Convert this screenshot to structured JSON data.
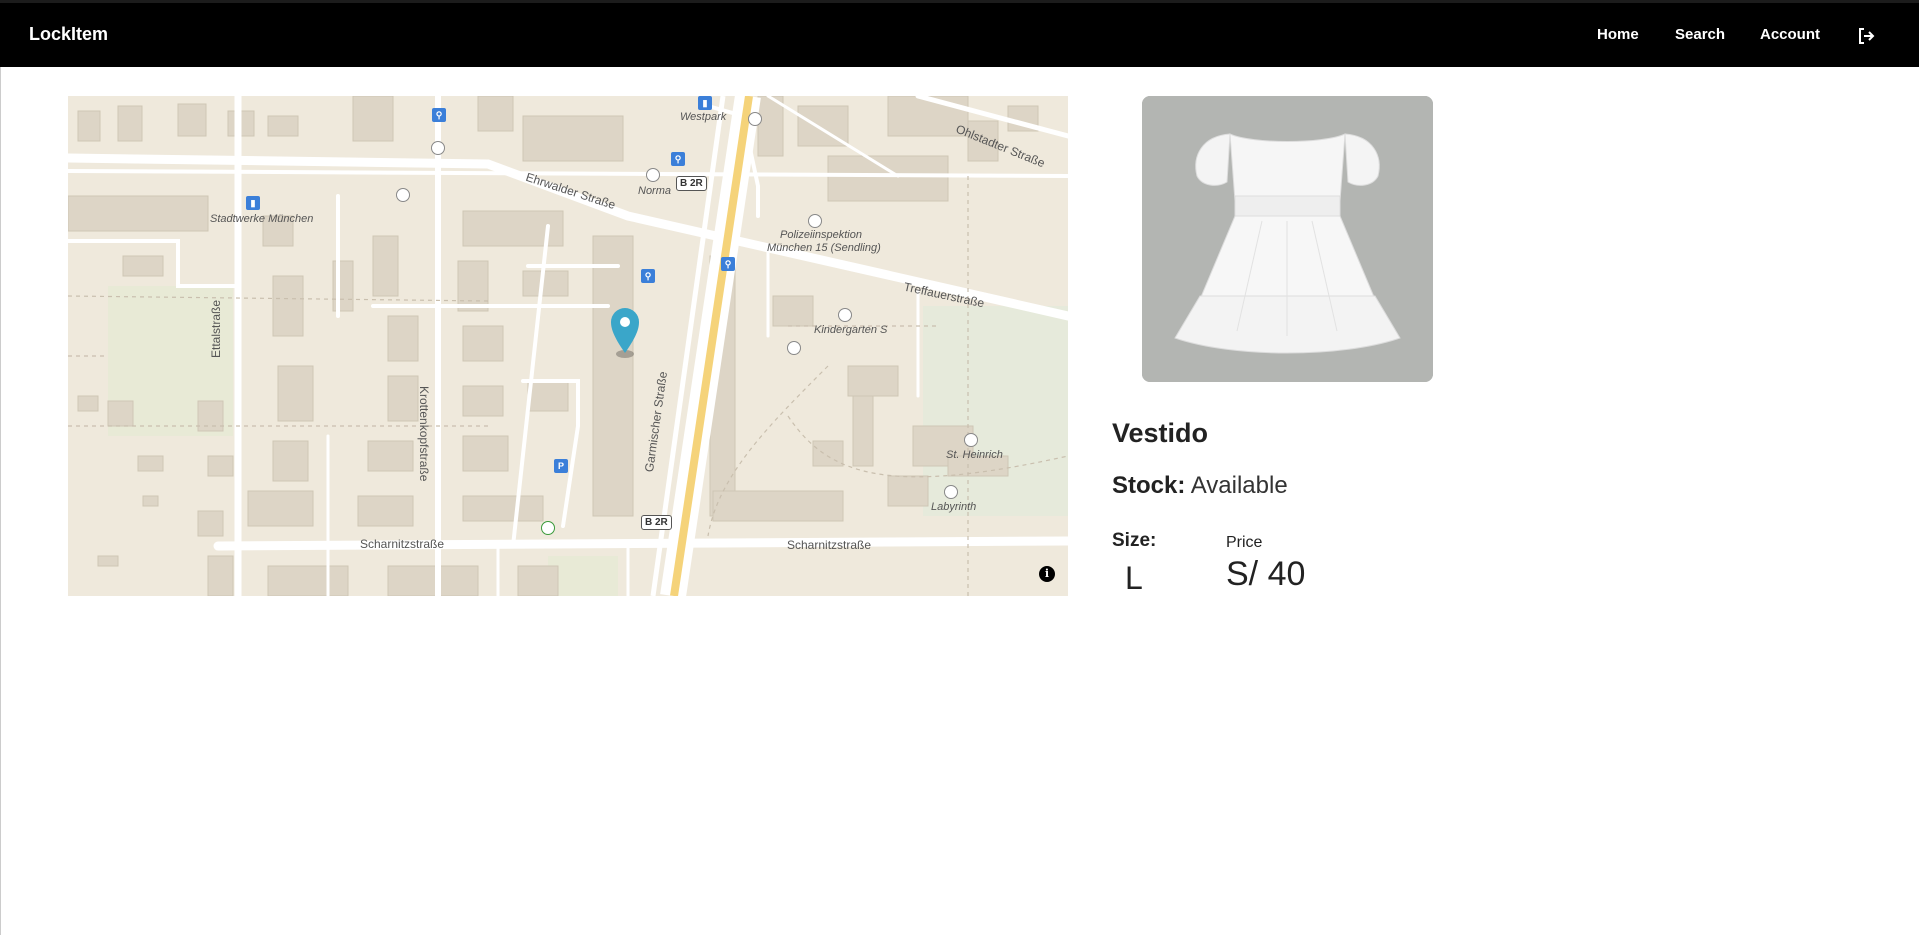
{
  "app": {
    "brand": "LockItem"
  },
  "nav": {
    "home": "Home",
    "search": "Search",
    "account": "Account",
    "logout_icon": "logout-icon"
  },
  "map": {
    "streets": {
      "ehrwalder": "Ehrwalder Straße",
      "ohlstadter": "Ohlstadter Straße",
      "treffauer": "Treffauerstraße",
      "ettal": "Ettalstraße",
      "krottenkopf": "Krottenkopfstraße",
      "garmischer": "Garmischer Straße",
      "scharnitz_left": "Scharnitzstraße",
      "scharnitz_right": "Scharnitzstraße"
    },
    "places": {
      "westpark": "Westpark",
      "norma": "Norma",
      "stadtwerke": "Stadtwerke München",
      "polizei_line1": "Polizeiinspektion",
      "polizei_line2": "München 15 (Sendling)",
      "kindergarten": "Kindergarten S",
      "st_heinrich": "St. Heinrich",
      "labyrinth": "Labyrinth"
    },
    "road_badges": {
      "top": "B 2R",
      "bottom": "B 2R"
    },
    "parking": "P",
    "info_icon": "i"
  },
  "product": {
    "name": "Vestido",
    "stock_label": "Stock:",
    "stock_value": "Available",
    "size_label": "Size:",
    "size_value": "L",
    "price_label": "Price",
    "price_value": "S/ 40"
  },
  "colors": {
    "navbar": "#000000",
    "marker": "#3aa6c9",
    "image_bg": "#b3b5b2"
  }
}
